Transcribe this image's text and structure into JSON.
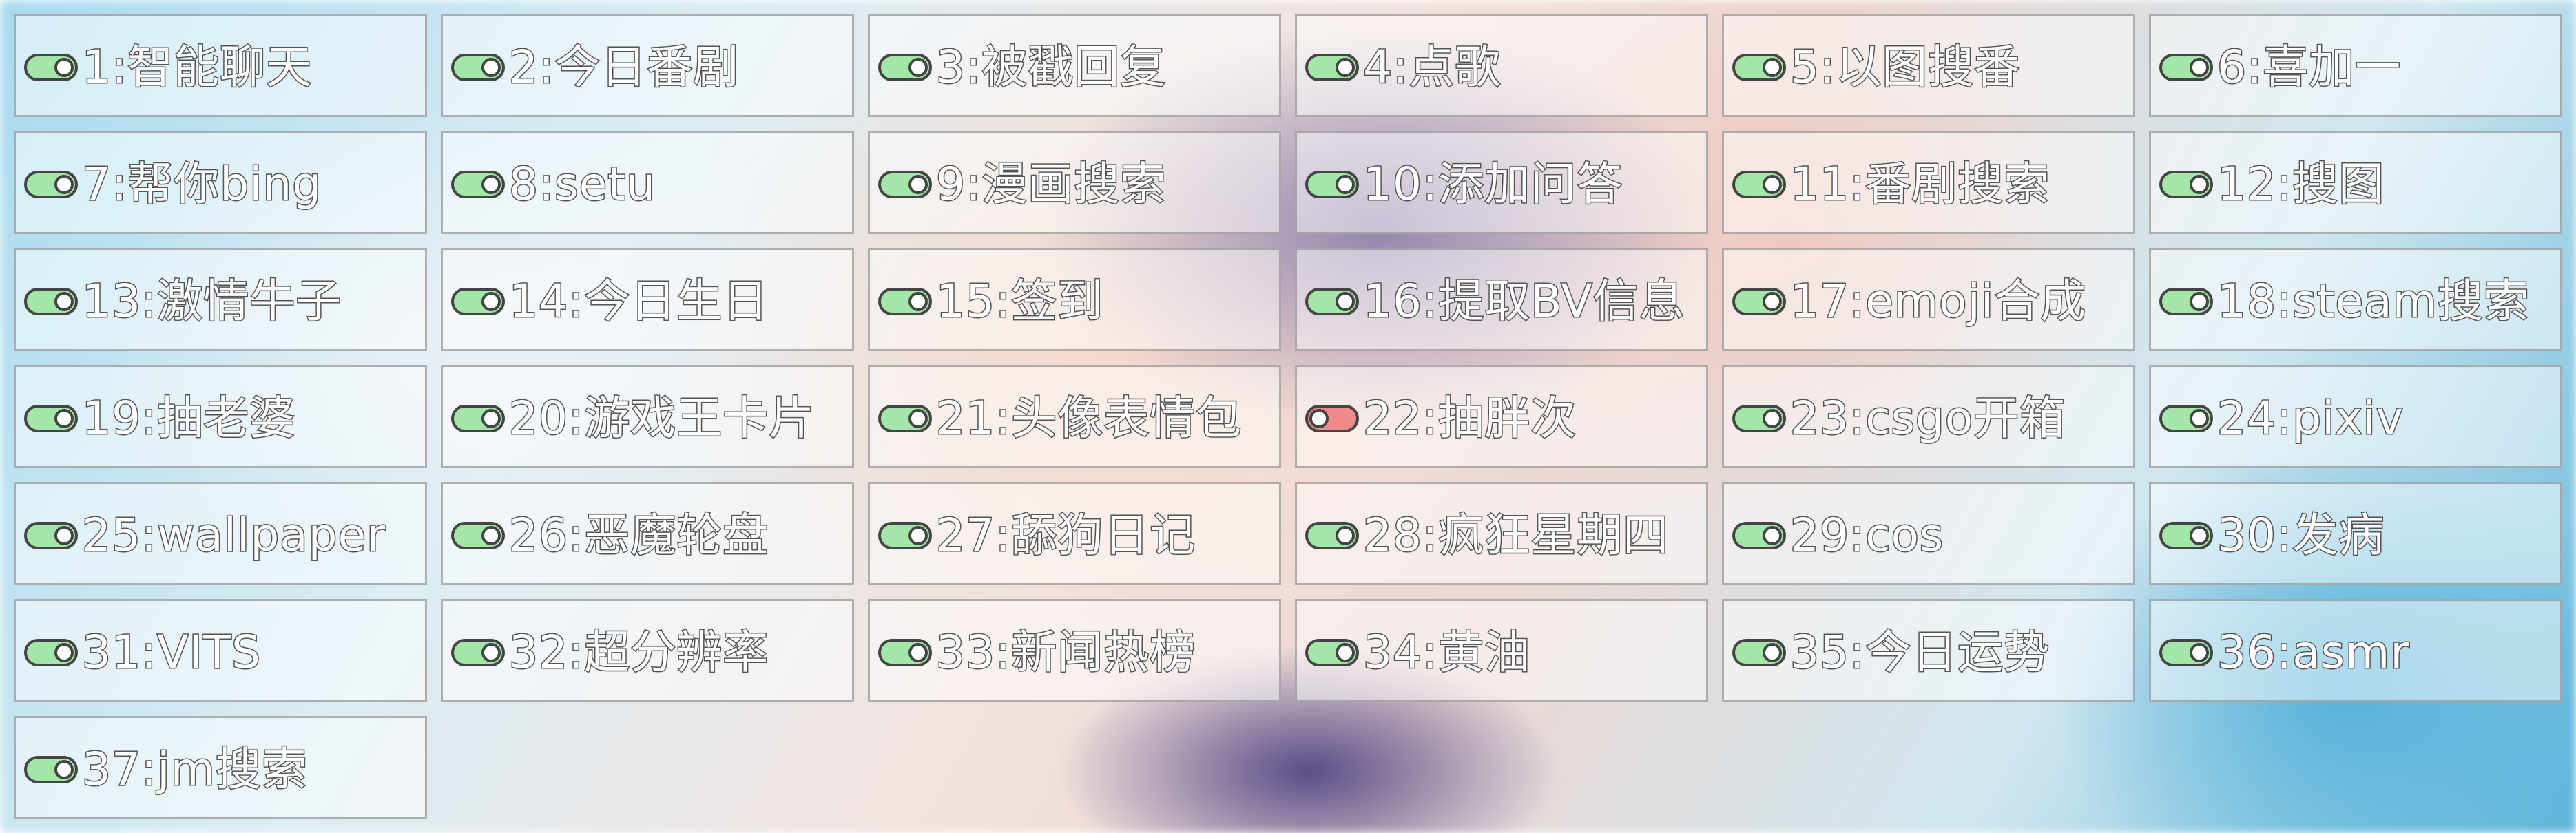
{
  "colors": {
    "toggle_on": "#a2e7a8",
    "toggle_off": "#f08a8a",
    "label_fill": "#ffffff",
    "label_outline": "#555555"
  },
  "items": [
    {
      "label": "1:智能聊天",
      "enabled": true
    },
    {
      "label": "2:今日番剧",
      "enabled": true
    },
    {
      "label": "3:被戳回复",
      "enabled": true
    },
    {
      "label": "4:点歌",
      "enabled": true
    },
    {
      "label": "5:以图搜番",
      "enabled": true
    },
    {
      "label": "6:喜加一",
      "enabled": true
    },
    {
      "label": "7:帮你bing",
      "enabled": true
    },
    {
      "label": "8:setu",
      "enabled": true
    },
    {
      "label": "9:漫画搜索",
      "enabled": true
    },
    {
      "label": "10:添加问答",
      "enabled": true
    },
    {
      "label": "11:番剧搜索",
      "enabled": true
    },
    {
      "label": "12:搜图",
      "enabled": true
    },
    {
      "label": "13:激情牛子",
      "enabled": true
    },
    {
      "label": "14:今日生日",
      "enabled": true
    },
    {
      "label": "15:签到",
      "enabled": true
    },
    {
      "label": "16:提取BV信息",
      "enabled": true
    },
    {
      "label": "17:emoji合成",
      "enabled": true
    },
    {
      "label": "18:steam搜索",
      "enabled": true
    },
    {
      "label": "19:抽老婆",
      "enabled": true
    },
    {
      "label": "20:游戏王卡片",
      "enabled": true
    },
    {
      "label": "21:头像表情包",
      "enabled": true
    },
    {
      "label": "22:抽胖次",
      "enabled": false
    },
    {
      "label": "23:csgo开箱",
      "enabled": true
    },
    {
      "label": "24:pixiv",
      "enabled": true
    },
    {
      "label": "25:wallpaper",
      "enabled": true
    },
    {
      "label": "26:恶魔轮盘",
      "enabled": true
    },
    {
      "label": "27:舔狗日记",
      "enabled": true
    },
    {
      "label": "28:疯狂星期四",
      "enabled": true
    },
    {
      "label": "29:cos",
      "enabled": true
    },
    {
      "label": "30:发病",
      "enabled": true
    },
    {
      "label": "31:VITS",
      "enabled": true
    },
    {
      "label": "32:超分辨率",
      "enabled": true
    },
    {
      "label": "33:新闻热榜",
      "enabled": true
    },
    {
      "label": "34:黄油",
      "enabled": true
    },
    {
      "label": "35:今日运势",
      "enabled": true
    },
    {
      "label": "36:asmr",
      "enabled": true
    },
    {
      "label": "37:jm搜索",
      "enabled": true
    }
  ]
}
